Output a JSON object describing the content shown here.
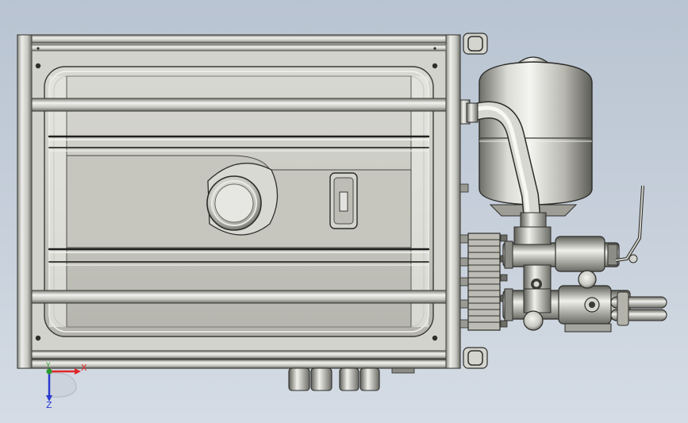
{
  "viewport": {
    "background_top": "#b9c4d2",
    "background_bottom": "#d5dce5"
  },
  "model": {
    "parts": [
      "tank-frame",
      "fuel-tank",
      "filler-cap",
      "sight-gauge",
      "expansion-vessel",
      "supply-pipe",
      "plate-heat-exchanger",
      "valve-manifold",
      "ball-valve-handle",
      "outlet-pipes",
      "bottom-fittings"
    ],
    "metal_light": "#eeeeea",
    "metal_mid": "#b9b9b2",
    "metal_dark": "#5a5a55"
  },
  "triad": {
    "x_label": "X",
    "y_label": "Y",
    "z_label": "Z",
    "x_color": "#e0282a",
    "y_color": "#2a9a2a",
    "z_color": "#2a3ad0"
  }
}
